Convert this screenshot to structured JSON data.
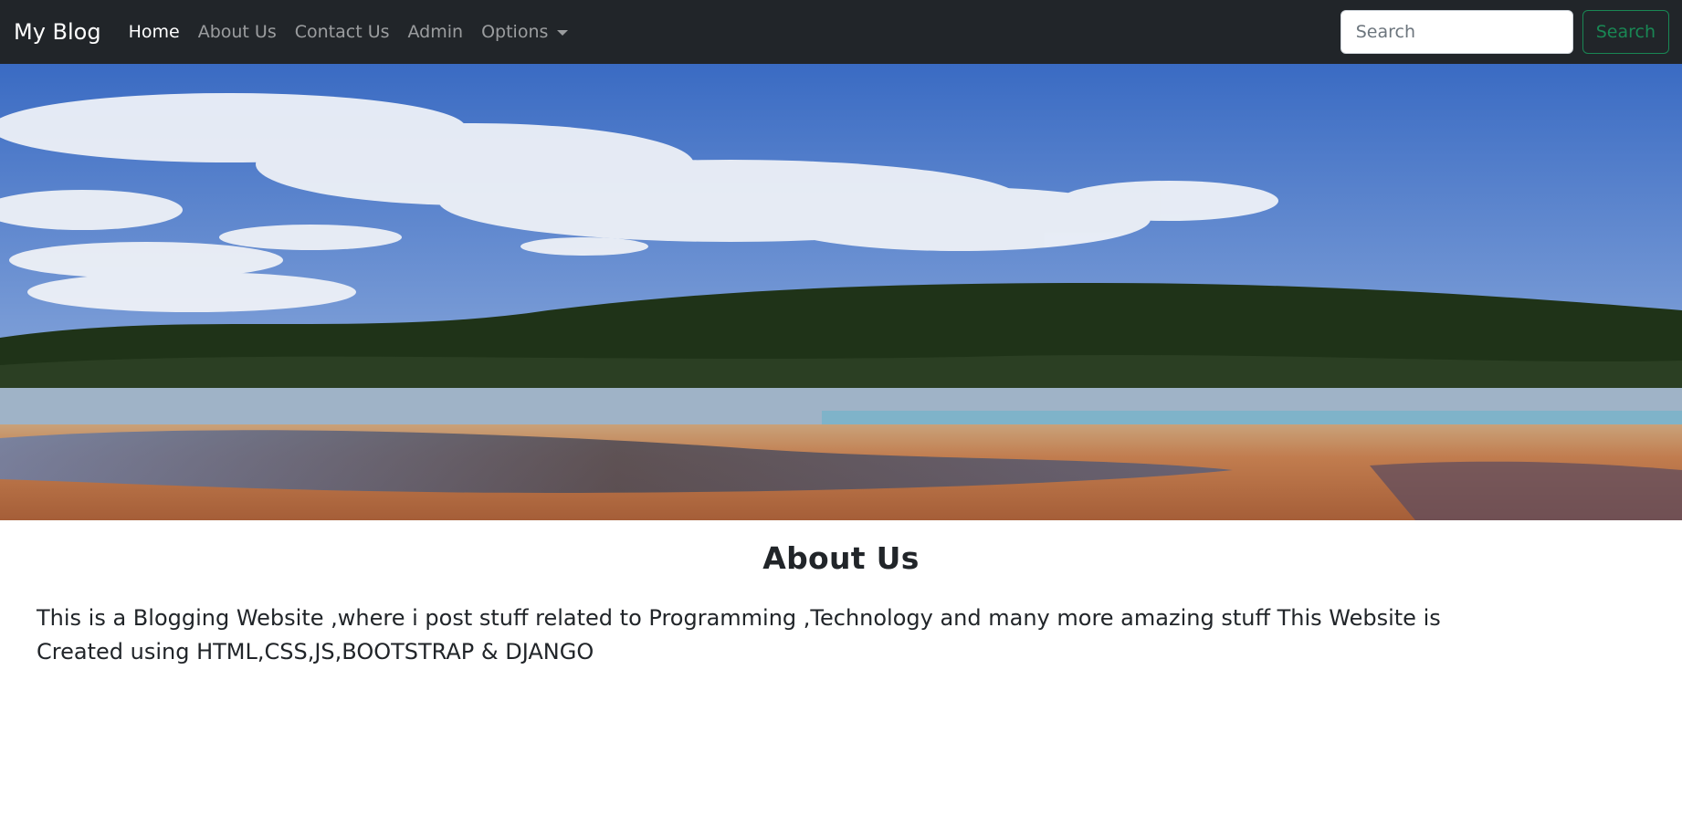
{
  "navbar": {
    "brand": "My Blog",
    "links": [
      {
        "label": "Home",
        "active": true
      },
      {
        "label": "About Us",
        "active": false
      },
      {
        "label": "Contact Us",
        "active": false
      },
      {
        "label": "Admin",
        "active": false
      }
    ],
    "dropdown": {
      "label": "Options",
      "icon": "caret-down-icon"
    },
    "search": {
      "placeholder": "Search",
      "button_label": "Search"
    }
  },
  "hero": {
    "image": "landscape-banner"
  },
  "main": {
    "title": "About Us",
    "description": "This is a Blogging Website ,where i post stuff related to Programming ,Technology and many more amazing stuff This Website is Created using HTML,CSS,JS,BOOTSTRAP & DJANGO"
  },
  "colors": {
    "navbar_bg": "#212529",
    "search_button": "#198754"
  }
}
